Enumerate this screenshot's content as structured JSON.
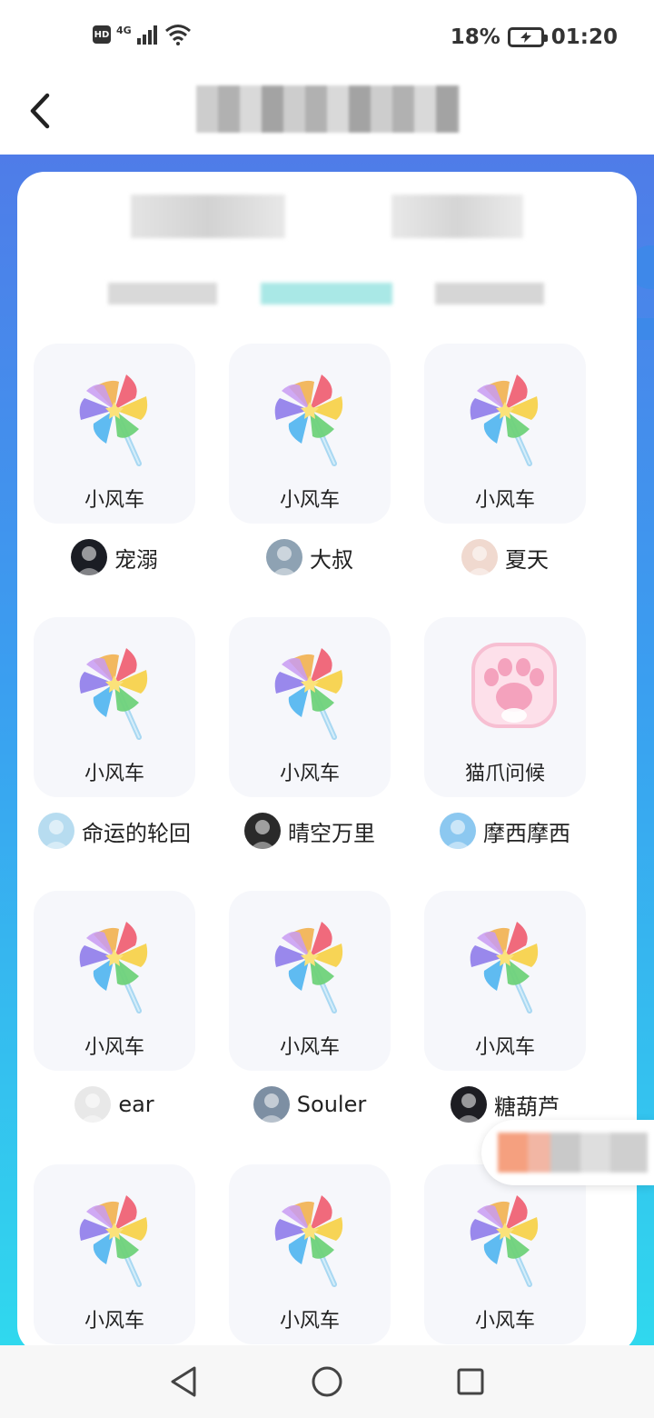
{
  "status_bar": {
    "hd_badge": "HD",
    "network": "4G",
    "battery": "18%",
    "time": "01:20"
  },
  "header": {
    "back_icon": "chevron-left-icon"
  },
  "gifts": [
    {
      "name": "小风车",
      "owner": "宠溺",
      "icon": "pinwheel-icon",
      "avatar_color": "#1b1d24"
    },
    {
      "name": "小风车",
      "owner": "大叔",
      "icon": "pinwheel-icon",
      "avatar_color": "#8ea2b3"
    },
    {
      "name": "小风车",
      "owner": "夏天",
      "icon": "pinwheel-icon",
      "avatar_color": "#f0d9cf"
    },
    {
      "name": "小风车",
      "owner": "命运的轮回",
      "icon": "pinwheel-icon",
      "avatar_color": "#b7dcf0"
    },
    {
      "name": "小风车",
      "owner": "晴空万里",
      "icon": "pinwheel-icon",
      "avatar_color": "#2a2a2a"
    },
    {
      "name": "猫爪问候",
      "owner": "摩西摩西",
      "icon": "cat-paw-icon",
      "avatar_color": "#8cc8f0"
    },
    {
      "name": "小风车",
      "owner": "ear",
      "icon": "pinwheel-icon",
      "avatar_color": "#e8e8e8"
    },
    {
      "name": "小风车",
      "owner": "Souler",
      "icon": "pinwheel-icon",
      "avatar_color": "#7d8fa3"
    },
    {
      "name": "小风车",
      "owner": "糖葫芦",
      "icon": "pinwheel-icon",
      "avatar_color": "#1d1d22"
    },
    {
      "name": "小风车",
      "owner": "",
      "icon": "pinwheel-icon",
      "avatar_color": ""
    },
    {
      "name": "小风车",
      "owner": "",
      "icon": "pinwheel-icon",
      "avatar_color": ""
    },
    {
      "name": "小风车",
      "owner": "",
      "icon": "pinwheel-icon",
      "avatar_color": ""
    }
  ],
  "nav_bar": {
    "back": "triangle-back-icon",
    "home": "circle-home-icon",
    "recents": "square-recents-icon"
  }
}
